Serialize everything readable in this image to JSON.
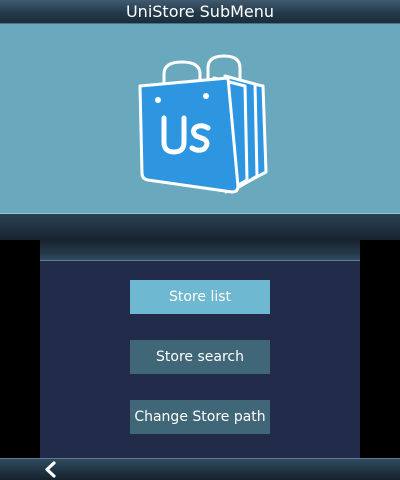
{
  "title_bar": {
    "title": "UniStore SubMenu"
  },
  "app_icon": {
    "name": "unistore-bag-icon",
    "text": "Us",
    "color": "#2e96e0"
  },
  "menu": {
    "items": [
      {
        "label": "Store list",
        "selected": true
      },
      {
        "label": "Store search",
        "selected": false
      },
      {
        "label": "Change Store path",
        "selected": false
      }
    ]
  },
  "colors": {
    "top_background": "#6aa9bd",
    "bottom_background": "#232b4a",
    "button_selected": "#6fb8d2",
    "button_normal": "#3f6778"
  },
  "navigation": {
    "back_icon": "chevron-left-icon"
  }
}
